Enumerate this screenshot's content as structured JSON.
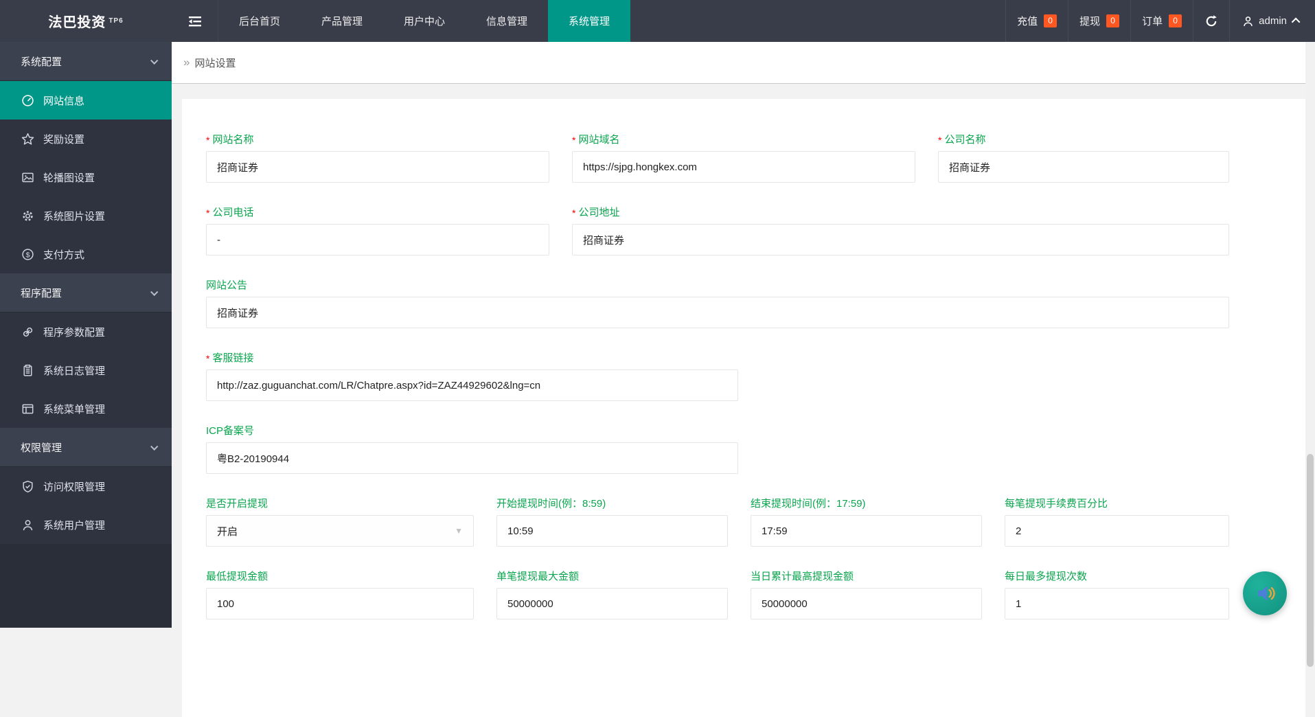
{
  "app": {
    "logo": "法巴投资",
    "logo_badge": "TP6"
  },
  "colors": {
    "accent_teal": "#009688",
    "label_green": "#0aa54e",
    "badge_orange": "#ff5722",
    "topbar_dark": "#393d49",
    "sidebar_dark": "#2f3340"
  },
  "icons": {
    "caret_down": "▼",
    "breadcrumb_chevron": "»"
  },
  "topbar": {
    "tabs": [
      {
        "label": "后台首页"
      },
      {
        "label": "产品管理"
      },
      {
        "label": "用户中心"
      },
      {
        "label": "信息管理"
      },
      {
        "label": "系统管理",
        "active": true
      }
    ],
    "stats": [
      {
        "label": "充值",
        "count": "0"
      },
      {
        "label": "提现",
        "count": "0"
      },
      {
        "label": "订单",
        "count": "0"
      }
    ],
    "user": {
      "name": "admin"
    }
  },
  "sidebar": {
    "sections": [
      {
        "label": "系统配置",
        "items": [
          {
            "icon": "gauge-icon",
            "label": "网站信息",
            "active": true
          },
          {
            "icon": "star-icon",
            "label": "奖励设置"
          },
          {
            "icon": "image-icon",
            "label": "轮播图设置"
          },
          {
            "icon": "gear-icon",
            "label": "系统图片设置"
          },
          {
            "icon": "dollar-icon",
            "label": "支付方式"
          }
        ]
      },
      {
        "label": "程序配置",
        "items": [
          {
            "icon": "link-icon",
            "label": "程序参数配置"
          },
          {
            "icon": "clipboard-icon",
            "label": "系统日志管理"
          },
          {
            "icon": "window-icon",
            "label": "系统菜单管理"
          }
        ]
      },
      {
        "label": "权限管理",
        "items": [
          {
            "icon": "shield-check-icon",
            "label": "访问权限管理"
          },
          {
            "icon": "user-icon",
            "label": "系统用户管理"
          }
        ]
      }
    ]
  },
  "breadcrumb": {
    "label": "网站设置"
  },
  "form": {
    "required_marker": "*",
    "fields": [
      {
        "key": "site-name",
        "label": "网站名称",
        "required": true,
        "value": "招商证券"
      },
      {
        "key": "site-domain",
        "label": "网站域名",
        "required": true,
        "value": "https://sjpg.hongkex.com"
      },
      {
        "key": "company-name",
        "label": "公司名称",
        "required": true,
        "value": "招商证券"
      },
      {
        "key": "company-phone",
        "label": "公司电话",
        "required": true,
        "value": "-"
      },
      {
        "key": "company-address",
        "label": "公司地址",
        "required": true,
        "value": "招商证券"
      },
      {
        "key": "site-notice",
        "label": "网站公告",
        "required": false,
        "value": "招商证券"
      },
      {
        "key": "service-link",
        "label": "客服链接",
        "required": true,
        "value": "http://zaz.guguanchat.com/LR/Chatpre.aspx?id=ZAZ44929602&lng=cn"
      },
      {
        "key": "icp-number",
        "label": "ICP备案号",
        "required": false,
        "value": "粤B2-20190944"
      },
      {
        "key": "withdraw-enabled",
        "label": "是否开启提现",
        "required": false,
        "value": "开启",
        "type": "select"
      },
      {
        "key": "withdraw-start-time",
        "label": "开始提现时间(例：8:59)",
        "required": false,
        "value": "10:59"
      },
      {
        "key": "withdraw-end-time",
        "label": "结束提现时间(例：17:59)",
        "required": false,
        "value": "17:59"
      },
      {
        "key": "withdraw-fee-percent",
        "label": "每笔提现手续费百分比",
        "required": false,
        "value": "2"
      },
      {
        "key": "withdraw-min-amount",
        "label": "最低提现金额",
        "required": false,
        "value": "100"
      },
      {
        "key": "withdraw-max-single",
        "label": "单笔提现最大金额",
        "required": false,
        "value": "50000000"
      },
      {
        "key": "withdraw-daily-max-amount",
        "label": "当日累计最高提现金额",
        "required": false,
        "value": "50000000"
      },
      {
        "key": "withdraw-daily-max-count",
        "label": "每日最多提现次数",
        "required": false,
        "value": "1"
      }
    ]
  }
}
